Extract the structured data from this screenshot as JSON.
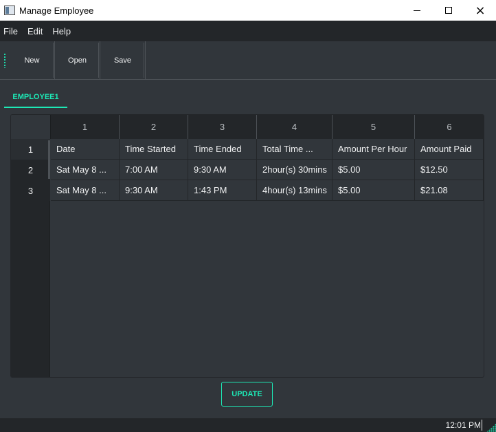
{
  "window": {
    "title": "Manage Employee",
    "controls": {
      "minimize": "minimize-icon",
      "maximize": "maximize-icon",
      "close": "×"
    }
  },
  "menubar": {
    "items": [
      "File",
      "Edit",
      "Help"
    ]
  },
  "toolbar": {
    "buttons": [
      "New",
      "Open",
      "Save"
    ]
  },
  "tabs": [
    {
      "label": "EMPLOYEE1",
      "active": true
    }
  ],
  "table": {
    "column_numbers": [
      "1",
      "2",
      "3",
      "4",
      "5",
      "6"
    ],
    "row_numbers": [
      "1",
      "2",
      "3"
    ],
    "rows": [
      [
        "Date",
        "Time Started",
        "Time Ended",
        "Total Time ...",
        "Amount Per Hour",
        "Amount Paid"
      ],
      [
        "Sat May 8 ...",
        "7:00 AM",
        "9:30 AM",
        "2hour(s) 30mins",
        "$5.00",
        "$12.50"
      ],
      [
        "Sat May 8 ...",
        "9:30 AM",
        "1:43 PM",
        "4hour(s) 13mins",
        "$5.00",
        "$21.08"
      ]
    ]
  },
  "actions": {
    "update_label": "UPDATE"
  },
  "statusbar": {
    "time": "12:01 PM"
  },
  "colors": {
    "accent": "#1de9b6",
    "background": "#31363b",
    "panel": "#232629",
    "text": "#eff0f1"
  }
}
